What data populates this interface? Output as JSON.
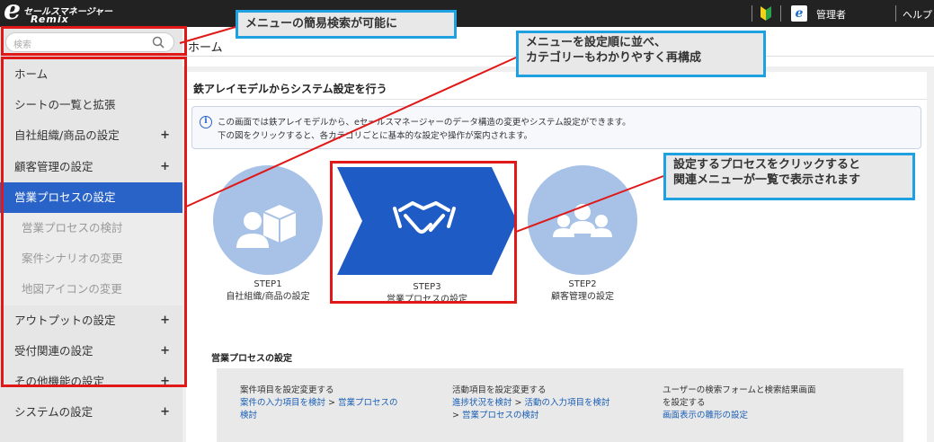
{
  "app": {
    "logo_line1": "セールスマネージャー",
    "logo_line2": "Remix",
    "admin_label": "管理者",
    "help_label": "ヘルプ"
  },
  "sidebar": {
    "search_placeholder": "検索",
    "items": [
      {
        "label": "ホーム",
        "plus": ""
      },
      {
        "label": "シートの一覧と拡張",
        "plus": ""
      },
      {
        "label": "自社組織/商品の設定",
        "plus": "+"
      },
      {
        "label": "顧客管理の設定",
        "plus": "+"
      },
      {
        "label": "営業プロセスの設定",
        "plus": ""
      },
      {
        "label": "営業プロセスの検討",
        "plus": ""
      },
      {
        "label": "案件シナリオの変更",
        "plus": ""
      },
      {
        "label": "地図アイコンの変更",
        "plus": ""
      },
      {
        "label": "アウトプットの設定",
        "plus": "+"
      },
      {
        "label": "受付関連の設定",
        "plus": "+"
      },
      {
        "label": "その他機能の設定",
        "plus": "+"
      },
      {
        "label": "システムの設定",
        "plus": "+"
      }
    ]
  },
  "main": {
    "page_title": "ホーム",
    "panel_title": "鉄アレイモデルからシステム設定を行う",
    "info_line1": "この画面では鉄アレイモデルから、eセールスマネージャーのデータ構造の変更やシステム設定ができます。",
    "info_line2": "下の図をクリックすると、各カテゴリごとに基本的な設定や操作が案内されます。",
    "steps": {
      "step1_num": "STEP1",
      "step1_name": "自社組織/商品の設定",
      "step3_num": "STEP3",
      "step3_name": "営業プロセスの設定",
      "step2_num": "STEP2",
      "step2_name": "顧客管理の設定"
    },
    "section_title": "営業プロセスの設定",
    "related": {
      "col1_head": "案件項目を設定変更する",
      "col1_link1": "案件の入力項目を検討",
      "col1_gt": ">",
      "col1_link2a": "営業プロセスの",
      "col1_link2b": "検討",
      "col2_head": "活動項目を設定変更する",
      "col2_link1": "進捗状況を検討",
      "col2_gt1": ">",
      "col2_link2": "活動の入力項目を検討",
      "col2_gt2": ">",
      "col2_link3": "営業プロセスの検討",
      "col3_head1": "ユーザーの検索フォームと検索結果画面",
      "col3_head2": "を設定する",
      "col3_link": "画面表示の雛形の設定"
    }
  },
  "annotations": {
    "callout1": "メニューの簡易検索が可能に",
    "callout2_line1": "メニューを設定順に並べ、",
    "callout2_line2": "カテゴリーもわかりやすく再構成",
    "callout3_line1": "設定するプロセスをクリックすると",
    "callout3_line2": "関連メニューが一覧で表示されます"
  },
  "colors": {
    "topbar": "#222222",
    "active_menu": "#2a63c8",
    "step_circle": "#a7c2e6",
    "step_arrow": "#1f5bc4",
    "annotation_red": "#e01818",
    "annotation_blue": "#1fa0e0"
  }
}
